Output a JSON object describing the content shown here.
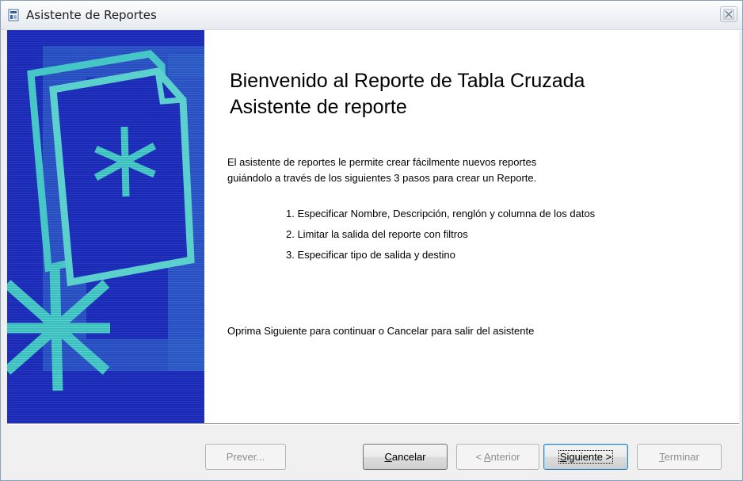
{
  "window": {
    "title": "Asistente de Reportes"
  },
  "content": {
    "heading_line1": "Bienvenido al Reporte de Tabla Cruzada",
    "heading_line2": "Asistente de reporte",
    "intro_line1": "El asistente de reportes le permite crear fácilmente nuevos reportes",
    "intro_line2": "guiándolo a través de los siguientes 3 pasos para crear un Reporte.",
    "steps": [
      "1. Especificar Nombre, Descripción, renglón y columna de los datos",
      "2. Limitar la salida del reporte con filtros",
      "3. Especificar tipo de salida y destino"
    ],
    "footer_instruction": "Oprima Siguiente para continuar o Cancelar para salir del asistente"
  },
  "buttons": {
    "preview": {
      "label": "Prever..."
    },
    "cancel": {
      "mnemonic": "C",
      "rest": "ancelar"
    },
    "back": {
      "prefix": "< ",
      "mnemonic": "A",
      "rest": "nterior"
    },
    "next": {
      "mnemonic": "S",
      "rest": "iguiente >"
    },
    "finish": {
      "mnemonic": "T",
      "rest": "erminar"
    }
  },
  "icons": {
    "app": "report-wizard-icon",
    "close": "close-icon",
    "art": "wizard-banner-art"
  },
  "colors": {
    "banner_blue": "#1a2ab3",
    "banner_teal": "#3ec0c0",
    "banner_mid": "#2f66c8"
  }
}
